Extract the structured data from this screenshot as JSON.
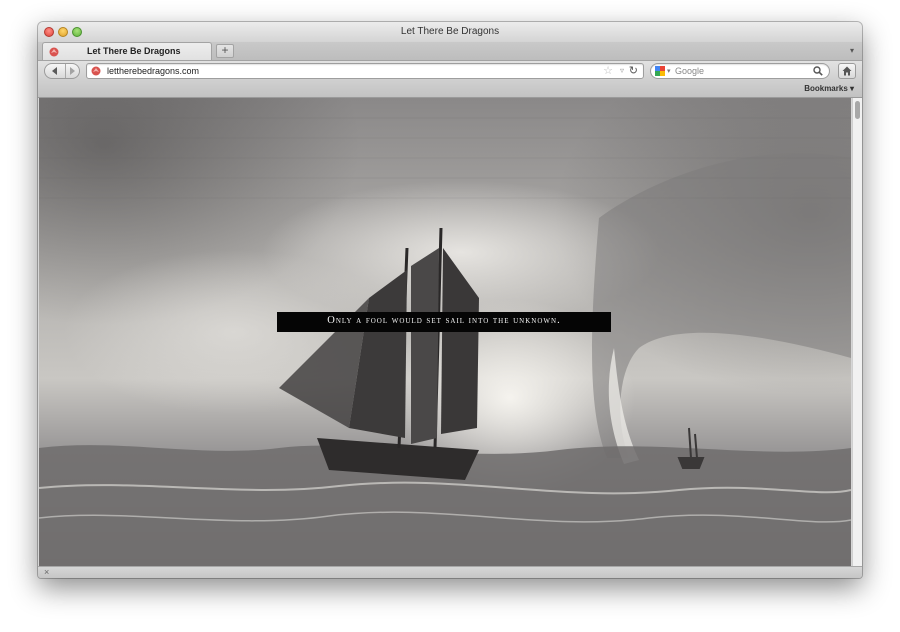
{
  "window": {
    "title": "Let There Be Dragons"
  },
  "tabs": [
    {
      "label": "Let There Be Dragons",
      "icon": "dragon-favicon-icon",
      "active": true
    }
  ],
  "toolbar": {
    "new_tab_label": "+",
    "tab_menu_label": "▾",
    "url": "lettherebedragons.com",
    "search_placeholder": "Google",
    "bookmarks_label": "Bookmarks ▾"
  },
  "page": {
    "caption": "Only a fool would set sail into the unknown.",
    "background": "engraving-ship-in-storm-with-waterspout"
  },
  "colors": {
    "caption_bg": "#050505",
    "caption_text": "#f5f5f5",
    "favicon": "#d9534f"
  }
}
